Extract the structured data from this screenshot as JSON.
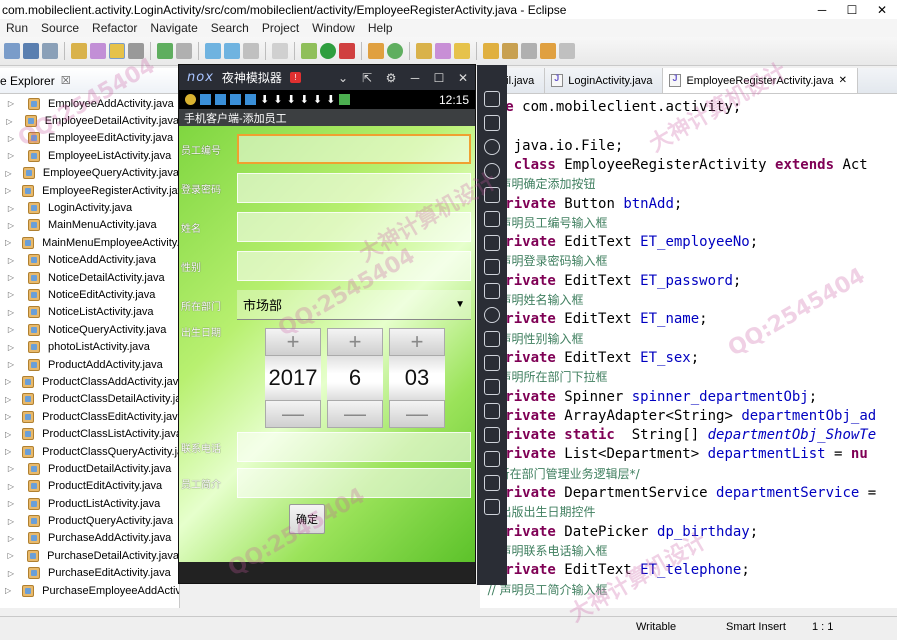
{
  "window": {
    "title": "com.mobileclient.activity.LoginActivity/src/com/mobileclient/activity/EmployeeRegisterActivity.java - Eclipse",
    "min": "─",
    "max": "☐",
    "close": "✕"
  },
  "menu": [
    "Run",
    "Source",
    "Refactor",
    "Navigate",
    "Search",
    "Project",
    "Window",
    "Help"
  ],
  "explorer": {
    "tab_label": "e Explorer",
    "close": "☒",
    "arrow": "▷",
    "files": [
      "EmployeeAddActivity.java",
      "EmployeeDetailActivity.java",
      "EmployeeEditActivity.java",
      "EmployeeListActivity.java",
      "EmployeeQueryActivity.java",
      "EmployeeRegisterActivity.java",
      "LoginActivity.java",
      "MainMenuActivity.java",
      "MainMenuEmployeeActivity.java",
      "NoticeAddActivity.java",
      "NoticeDetailActivity.java",
      "NoticeEditActivity.java",
      "NoticeListActivity.java",
      "NoticeQueryActivity.java",
      "photoListActivity.java",
      "ProductAddActivity.java",
      "ProductClassAddActivity.java",
      "ProductClassDetailActivity.java",
      "ProductClassEditActivity.java",
      "ProductClassListActivity.java",
      "ProductClassQueryActivity.java",
      "ProductDetailActivity.java",
      "ProductEditActivity.java",
      "ProductListActivity.java",
      "ProductQueryActivity.java",
      "PurchaseAddActivity.java",
      "PurchaseDetailActivity.java",
      "PurchaseEditActivity.java",
      "PurchaseEmployeeAddActivity.java"
    ]
  },
  "editor": {
    "tabs": [
      {
        "label": "tpUtil.java",
        "active": false
      },
      {
        "label": "LoginActivity.java",
        "active": false
      },
      {
        "label": "EmployeeRegisterActivity.java",
        "active": true
      }
    ],
    "tab_close": "✕",
    "lines": [
      [
        {
          "t": "kw",
          "v": "kage "
        },
        {
          "t": "plain",
          "v": "com.mobileclient.activity;"
        }
      ],
      [],
      [
        {
          "t": "kw",
          "v": "ort "
        },
        {
          "t": "plain",
          "v": "java.io.File;"
        }
      ],
      [
        {
          "t": "kw",
          "v": "lic class "
        },
        {
          "t": "plain",
          "v": "EmployeeRegisterActivity "
        },
        {
          "t": "kw",
          "v": "extends "
        },
        {
          "t": "plain",
          "v": "Act"
        }
      ],
      [
        {
          "t": "cmt",
          "v": "  // 声明确定添加按钮"
        }
      ],
      [
        {
          "t": "kw",
          "v": "  private "
        },
        {
          "t": "plain",
          "v": "Button "
        },
        {
          "t": "fld",
          "v": "btnAdd"
        },
        {
          "t": "plain",
          "v": ";"
        }
      ],
      [
        {
          "t": "cmt",
          "v": "  // 声明员工编号输入框"
        }
      ],
      [
        {
          "t": "kw",
          "v": "  private "
        },
        {
          "t": "plain",
          "v": "EditText "
        },
        {
          "t": "fld",
          "v": "ET_employeeNo"
        },
        {
          "t": "plain",
          "v": ";"
        }
      ],
      [
        {
          "t": "cmt",
          "v": "  // 声明登录密码输入框"
        }
      ],
      [
        {
          "t": "kw",
          "v": "  private "
        },
        {
          "t": "plain",
          "v": "EditText "
        },
        {
          "t": "fld",
          "v": "ET_password"
        },
        {
          "t": "plain",
          "v": ";"
        }
      ],
      [
        {
          "t": "cmt",
          "v": "  // 声明姓名输入框"
        }
      ],
      [
        {
          "t": "kw",
          "v": "  private "
        },
        {
          "t": "plain",
          "v": "EditText "
        },
        {
          "t": "fld",
          "v": "ET_name"
        },
        {
          "t": "plain",
          "v": ";"
        }
      ],
      [
        {
          "t": "cmt",
          "v": "  // 声明性别输入框"
        }
      ],
      [
        {
          "t": "kw",
          "v": "  private "
        },
        {
          "t": "plain",
          "v": "EditText "
        },
        {
          "t": "fld",
          "v": "ET_sex"
        },
        {
          "t": "plain",
          "v": ";"
        }
      ],
      [
        {
          "t": "cmt",
          "v": "  // 声明所在部门下拉框"
        }
      ],
      [
        {
          "t": "kw",
          "v": "  private "
        },
        {
          "t": "plain",
          "v": "Spinner "
        },
        {
          "t": "fld",
          "v": "spinner_departmentObj"
        },
        {
          "t": "plain",
          "v": ";"
        }
      ],
      [
        {
          "t": "kw",
          "v": "  private "
        },
        {
          "t": "plain",
          "v": "ArrayAdapter<String> "
        },
        {
          "t": "fld",
          "v": "departmentObj_ad"
        }
      ],
      [
        {
          "t": "kw",
          "v": "  private static  "
        },
        {
          "t": "plain",
          "v": "String[] "
        },
        {
          "t": "fldi",
          "v": "departmentObj_ShowTe"
        }
      ],
      [
        {
          "t": "kw",
          "v": "  private "
        },
        {
          "t": "plain",
          "v": "List<Department> "
        },
        {
          "t": "fld",
          "v": "departmentList"
        },
        {
          "t": "plain",
          "v": " = "
        },
        {
          "t": "kw",
          "v": "nu"
        }
      ],
      [
        {
          "t": "cmt",
          "v": "  /*所在部门管理业务逻辑层*/"
        }
      ],
      [
        {
          "t": "kw",
          "v": "  private "
        },
        {
          "t": "plain",
          "v": "DepartmentService "
        },
        {
          "t": "fld",
          "v": "departmentService"
        },
        {
          "t": "plain",
          "v": " ="
        }
      ],
      [
        {
          "t": "cmt",
          "v": "  // 出版出生日期控件"
        }
      ],
      [
        {
          "t": "kw",
          "v": "  private "
        },
        {
          "t": "plain",
          "v": "DatePicker "
        },
        {
          "t": "fld",
          "v": "dp_birthday"
        },
        {
          "t": "plain",
          "v": ";"
        }
      ],
      [
        {
          "t": "cmt",
          "v": "  // 声明联系电话输入框"
        }
      ],
      [
        {
          "t": "kw",
          "v": "  private "
        },
        {
          "t": "plain",
          "v": "EditText "
        },
        {
          "t": "fld",
          "v": "ET_telephone"
        },
        {
          "t": "plain",
          "v": ";"
        }
      ],
      [
        {
          "t": "cmt",
          "v": "  // 声明员工简介输入框"
        }
      ]
    ]
  },
  "emulator": {
    "title": "夜神模拟器",
    "logo": "nox",
    "badge": "!",
    "controls": [
      "⌄",
      "⇱",
      "⚙",
      "─",
      "☐",
      "✕"
    ],
    "time": "12:15",
    "app_title": "手机客户端-添加员工",
    "form": {
      "employee_no_label": "员工编号",
      "password_label": "登录密码",
      "name_label": "姓名",
      "sex_label": "性别",
      "department_label": "所在部门",
      "department_value": "市场部",
      "birthday_label": "出生日期",
      "telephone_label": "联系电话",
      "intro_label": "员工简介",
      "year": "2017",
      "month": "6",
      "day": "03",
      "plus": "+",
      "minus": "—",
      "submit": "确定"
    }
  },
  "statusbar": {
    "mode": "Writable",
    "insert": "Smart Insert",
    "position": "1 : 1"
  },
  "watermark": {
    "qq": "QQ:2545404",
    "brand": "大神计算机设计"
  }
}
